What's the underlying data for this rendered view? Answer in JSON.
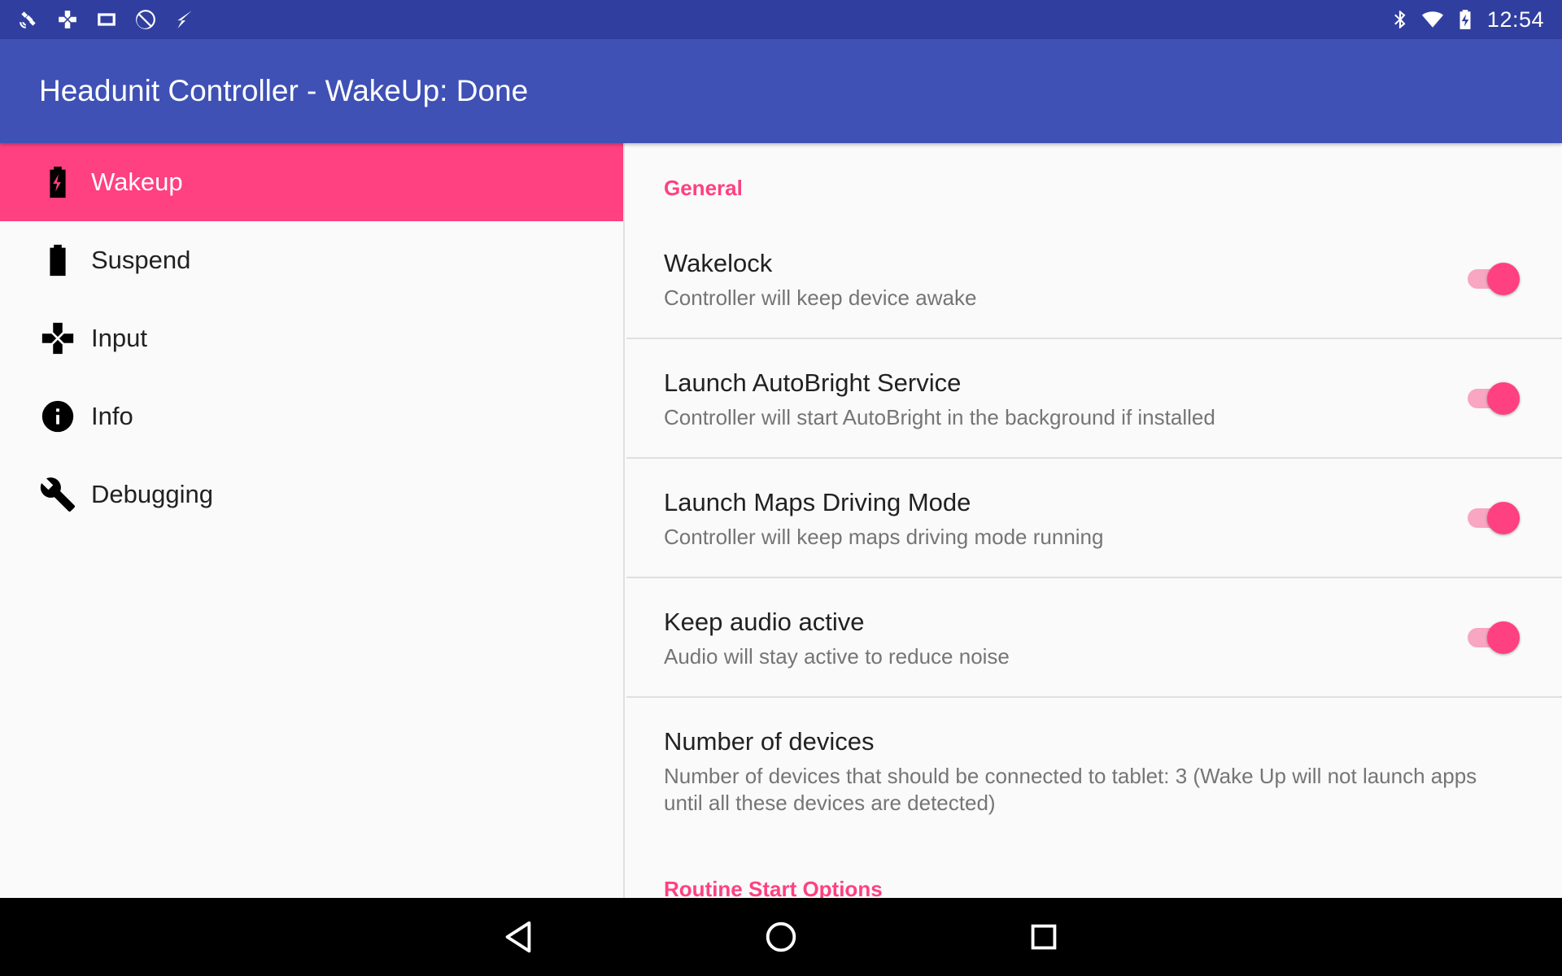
{
  "status_bar": {
    "left_icons": [
      "satellite-icon",
      "gamepad-icon",
      "screen-icon",
      "rotation-icon",
      "flash-icon"
    ],
    "right_icons": [
      "bluetooth-icon",
      "wifi-icon",
      "battery-charging-icon"
    ],
    "time": "12:54"
  },
  "app_bar": {
    "title": "Headunit Controller - WakeUp: Done"
  },
  "sidebar": {
    "items": [
      {
        "label": "Wakeup",
        "icon": "battery-charging-icon",
        "active": true
      },
      {
        "label": "Suspend",
        "icon": "battery-icon",
        "active": false
      },
      {
        "label": "Input",
        "icon": "gamepad-icon",
        "active": false
      },
      {
        "label": "Info",
        "icon": "info-icon",
        "active": false
      },
      {
        "label": "Debugging",
        "icon": "wrench-icon",
        "active": false
      }
    ]
  },
  "main": {
    "general_header": "General",
    "preferences": [
      {
        "title": "Wakelock",
        "summary": "Controller will keep device awake",
        "toggle": true
      },
      {
        "title": "Launch AutoBright Service",
        "summary": "Controller will start AutoBright in the background if installed",
        "toggle": true
      },
      {
        "title": "Launch Maps Driving Mode",
        "summary": "Controller will keep maps driving mode running",
        "toggle": true
      },
      {
        "title": "Keep audio active",
        "summary": "Audio will stay active to reduce noise",
        "toggle": true
      }
    ],
    "number_of_devices": {
      "title": "Number of devices",
      "summary": "Number of devices that should be connected to tablet: 3 (Wake Up will not launch apps until all these devices are detected)"
    },
    "routine_header": "Routine Start Options"
  },
  "colors": {
    "status_bar": "#303f9f",
    "app_bar": "#3f51b5",
    "accent": "#ff4081",
    "nav_bar": "#000000"
  },
  "nav_bar": {
    "buttons": [
      "back-icon",
      "home-icon",
      "recents-icon"
    ]
  }
}
